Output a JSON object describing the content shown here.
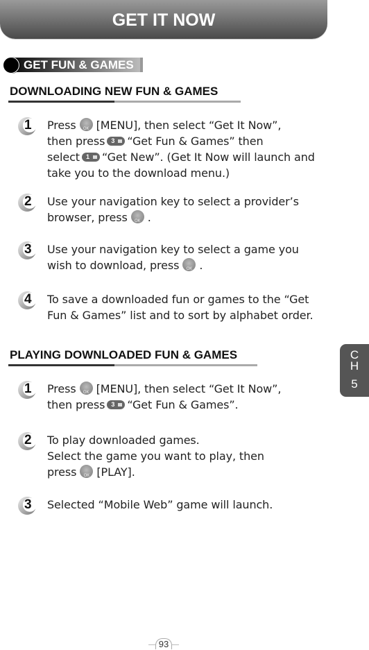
{
  "header": {
    "title": "GET IT NOW"
  },
  "tag": {
    "label": "GET FUN & GAMES"
  },
  "sections": [
    {
      "title": "DOWNLOADING NEW FUN & GAMES",
      "steps": [
        {
          "num": "1",
          "lines": [
            [
              "Press",
              "[MENU], then select “Get It Now”,"
            ],
            [
              "then press",
              "“Get Fun & Games” then"
            ],
            [
              "select",
              "“Get New”. (Get It Now will launch and"
            ],
            [
              "take you to the download menu.)"
            ]
          ]
        },
        {
          "num": "2",
          "lines": [
            [
              "Use your navigation key to select a provider’s"
            ],
            [
              "browser, press",
              "."
            ]
          ]
        },
        {
          "num": "3",
          "lines": [
            [
              "Use your navigation key to select a game you"
            ],
            [
              "wish to download, press",
              "."
            ]
          ]
        },
        {
          "num": "4",
          "lines": [
            [
              "To save a downloaded fun or games to the “Get"
            ],
            [
              "Fun & Games” list and to sort by alphabet order."
            ]
          ]
        }
      ]
    },
    {
      "title": "PLAYING DOWNLOADED FUN & GAMES",
      "steps": [
        {
          "num": "1",
          "lines": [
            [
              "Press",
              "[MENU], then select “Get It Now”,"
            ],
            [
              "then press",
              "“Get Fun & Games”."
            ]
          ]
        },
        {
          "num": "2",
          "lines": [
            [
              "To play downloaded games."
            ],
            [
              "Select the game you want to play, then"
            ],
            [
              "press",
              "[PLAY]."
            ]
          ]
        },
        {
          "num": "3",
          "lines": [
            [
              "Selected “Mobile Web” game will launch."
            ]
          ]
        }
      ]
    }
  ],
  "keys": {
    "three": "3",
    "one": "1"
  },
  "chapter_tab": {
    "line1": "C",
    "line2": "H",
    "line3": "5"
  },
  "page_number": "93"
}
